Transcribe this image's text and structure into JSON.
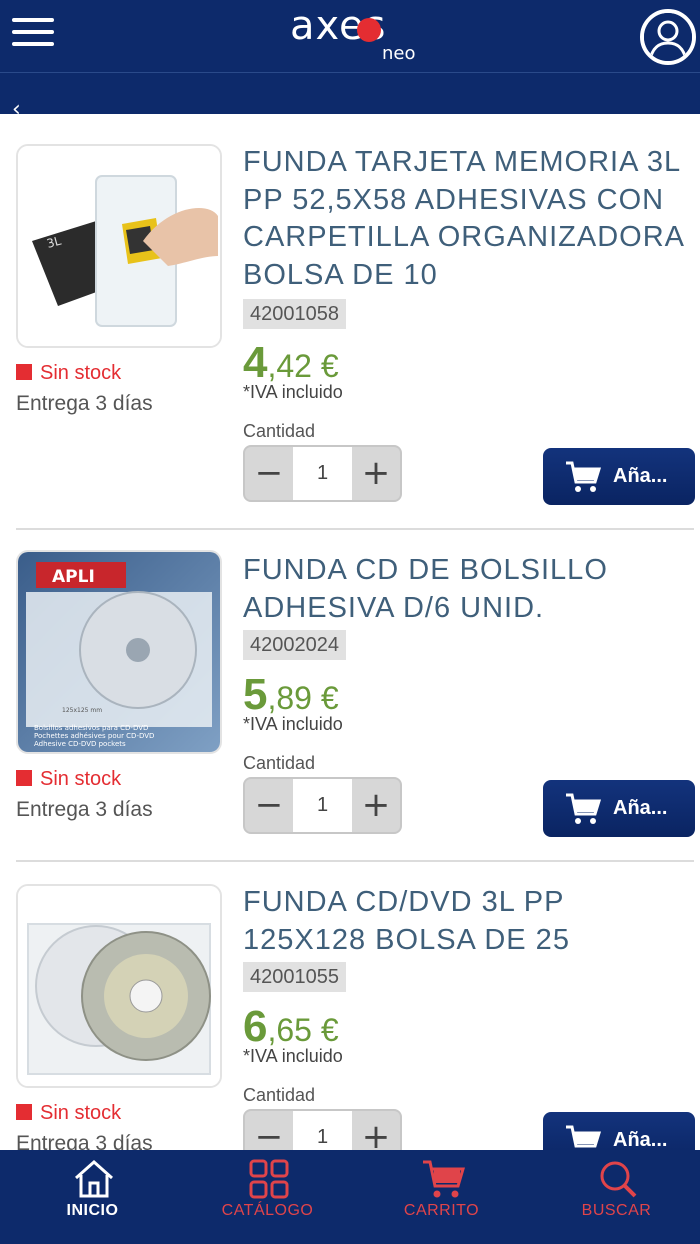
{
  "header": {
    "logo_text": "axes",
    "logo_sub": "neo"
  },
  "products": [
    {
      "title": "FUNDA TARJETA MEMORIA 3L PP 52,5x58 ADHESIVAS CON CARPETILLA ORGANIZADORA BOLSA DE 10",
      "ref": "42001058",
      "price_int": "4",
      "price_dec": ",42 €",
      "iva": "*IVA incluido",
      "stock": "Sin stock",
      "delivery": "Entrega 3 días",
      "qty_label": "Cantidad",
      "qty": "1",
      "add_label": "Aña..."
    },
    {
      "title": "FUNDA CD DE BOLSILLO ADHESIVA D/6 UNID.",
      "ref": "42002024",
      "price_int": "5",
      "price_dec": ",89 €",
      "iva": "*IVA incluido",
      "stock": "Sin stock",
      "delivery": "Entrega 3 días",
      "qty_label": "Cantidad",
      "qty": "1",
      "add_label": "Aña...",
      "image_text": {
        "brand": "APLI",
        "size": "125x125 mm",
        "line1": "Bolsillos adhesivos para CD-DVD",
        "line2": "Pochettes adhésives pour CD-DVD",
        "line3": "Adhesive CD-DVD pockets"
      }
    },
    {
      "title": "FUNDA CD/DVD 3L PP 125x128 BOLSA DE 25",
      "ref": "42001055",
      "price_int": "6",
      "price_dec": ",65 €",
      "iva": "*IVA incluido",
      "stock": "Sin stock",
      "delivery": "Entrega 3 días",
      "qty_label": "Cantidad",
      "qty": "1",
      "add_label": "Aña..."
    }
  ],
  "nav": [
    {
      "label": "INICIO",
      "active": true,
      "color": "#ffffff"
    },
    {
      "label": "CATÁLOGO",
      "active": false,
      "color": "#e0444a"
    },
    {
      "label": "CARRITO",
      "active": false,
      "color": "#e0444a"
    },
    {
      "label": "BUSCAR",
      "active": false,
      "color": "#e0444a"
    }
  ],
  "colors": {
    "primary": "#0d2a6b",
    "price": "#6a9a3a",
    "stock": "#e42d32",
    "title": "#3f5f7a"
  }
}
